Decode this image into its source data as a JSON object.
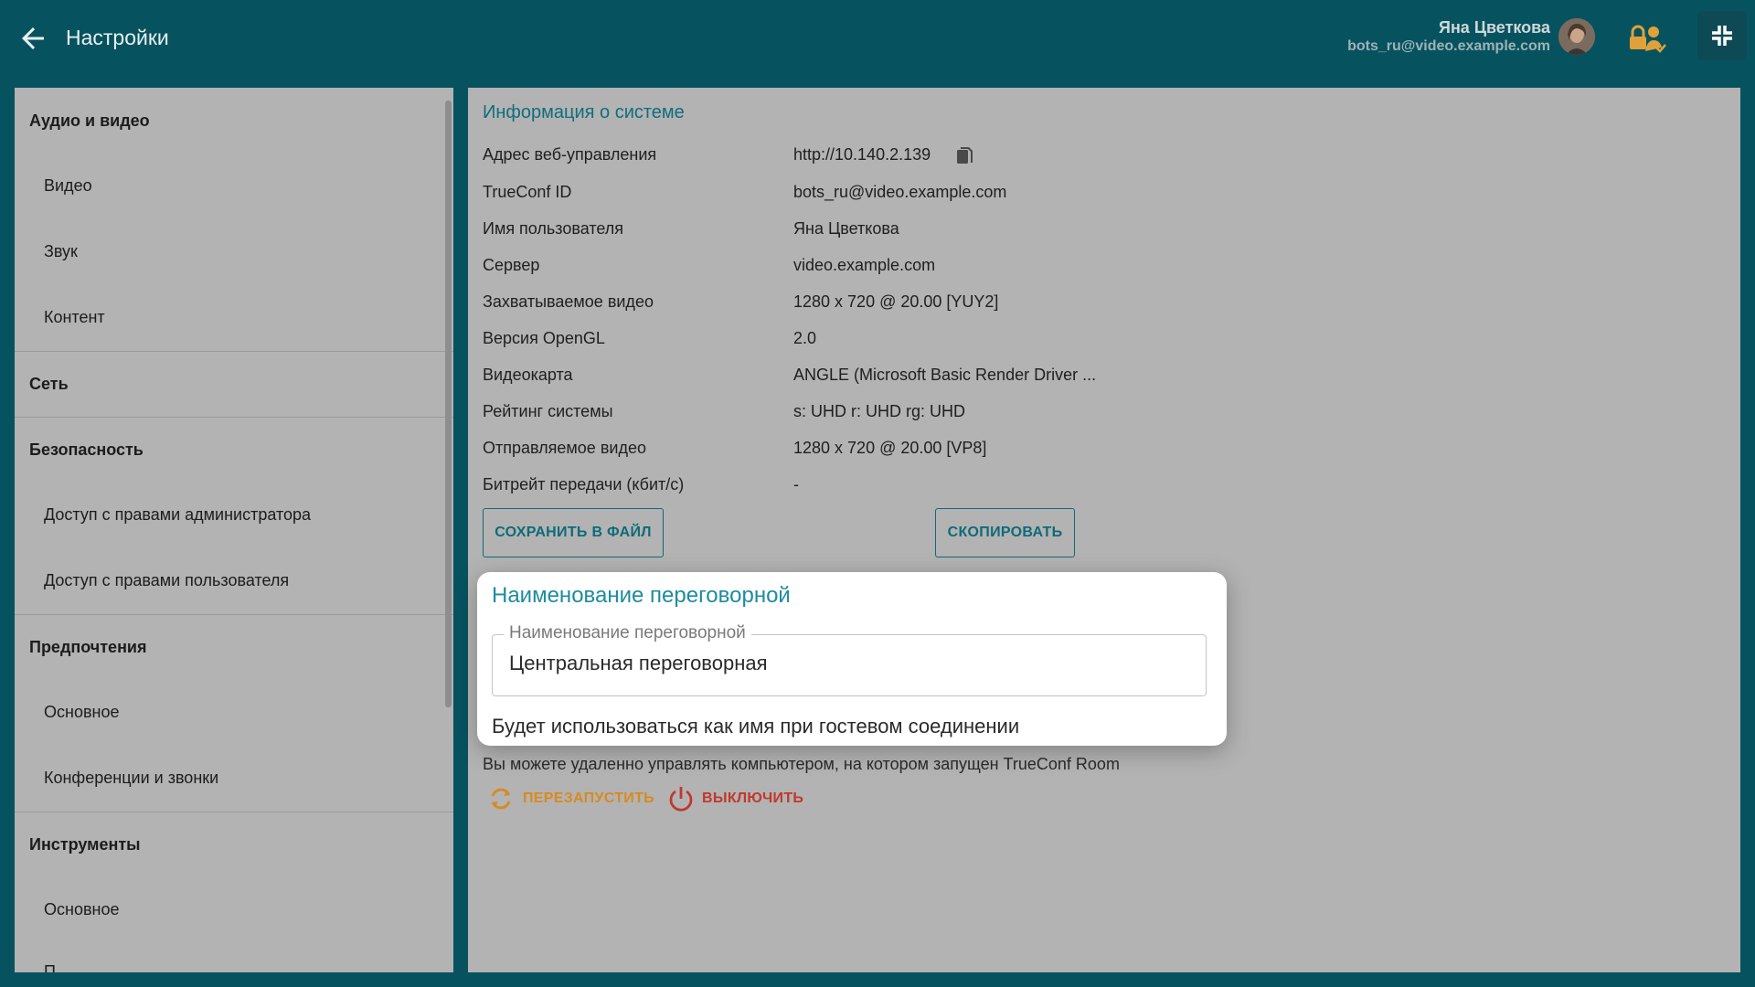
{
  "header": {
    "title": "Настройки",
    "user_name": "Яна Цветкова",
    "user_email": "bots_ru@video.example.com",
    "icons": {
      "back": "arrow-left-icon",
      "lock": "lock-user-icon",
      "collapse": "collapse-icon"
    }
  },
  "sidebar": {
    "sections": [
      {
        "label": "Аудио и видео",
        "items": [
          "Видео",
          "Звук",
          "Контент"
        ]
      },
      {
        "label": "Сеть",
        "items": []
      },
      {
        "label": "Безопасность",
        "items": [
          "Доступ с правами администратора",
          "Доступ с правами пользователя"
        ]
      },
      {
        "label": "Предпочтения",
        "items": [
          "Основное",
          "Конференции и звонки"
        ]
      },
      {
        "label": "Инструменты",
        "items": [
          "Основное",
          "П"
        ]
      }
    ]
  },
  "system_info": {
    "title": "Информация о системе",
    "rows": [
      {
        "label": "Адрес веб-управления",
        "value": "http://10.140.2.139"
      },
      {
        "label": "TrueConf ID",
        "value": "bots_ru@video.example.com"
      },
      {
        "label": "Имя пользователя",
        "value": "Яна Цветкова"
      },
      {
        "label": "Сервер",
        "value": "video.example.com"
      },
      {
        "label": "Захватываемое видео",
        "value": "1280 x 720 @ 20.00 [YUY2]"
      },
      {
        "label": "Версия OpenGL",
        "value": "2.0"
      },
      {
        "label": "Видеокарта",
        "value": "ANGLE (Microsoft Basic Render Driver ..."
      },
      {
        "label": "Рейтинг системы",
        "value": "s: UHD r: UHD rg: UHD"
      },
      {
        "label": "Отправляемое видео",
        "value": "1280 x 720 @ 20.00 [VP8]"
      },
      {
        "label": "Битрейт передачи (кбит/с)",
        "value": "-"
      }
    ],
    "save_button": "СОХРАНИТЬ В ФАЙЛ",
    "copy_button": "СКОПИРОВАТЬ"
  },
  "room_name": {
    "title": "Наименование переговорной",
    "field_label": "Наименование переговорной",
    "field_value": "Центральная переговорная",
    "hint": "Будет использоваться как имя при гостевом соединении"
  },
  "remote": {
    "text": "Вы можете удаленно управлять компьютером, на котором запущен TrueConf Room",
    "restart_label": "ПЕРЕЗАПУСТИТЬ",
    "shutdown_label": "ВЫКЛЮЧИТЬ"
  },
  "colors": {
    "header_bg": "#06535f",
    "accent": "#0e6b79",
    "restart": "#d98a1e",
    "shutdown": "#c0392b"
  }
}
